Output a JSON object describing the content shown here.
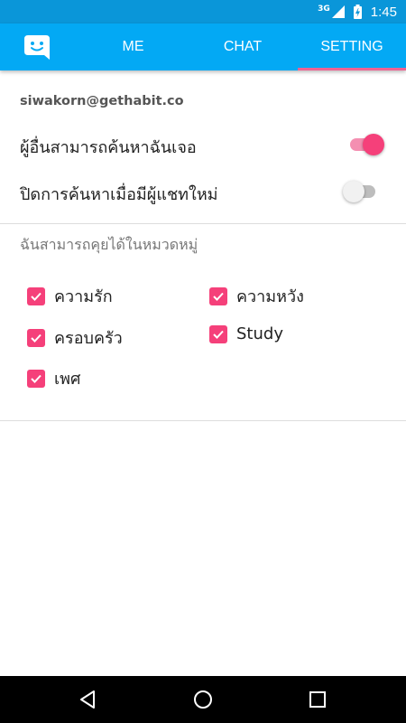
{
  "status_bar": {
    "network": "3G",
    "time": "1:45"
  },
  "app_bar": {
    "logo_icon": "smiley-chat-icon",
    "tabs": [
      {
        "label": "ME"
      },
      {
        "label": "CHAT"
      },
      {
        "label": "SETTING"
      }
    ],
    "active_tab": "SETTING"
  },
  "account": {
    "email": "siwakorn@gethabit.co"
  },
  "settings": [
    {
      "label": "ผู้อื่นสามารถค้นหาฉันเจอ",
      "enabled": true
    },
    {
      "label": "ปิดการค้นหาเมื่อมีผู้แชทใหม่",
      "enabled": false
    }
  ],
  "topics": {
    "title": "ฉันสามารถคุยได้ในหมวดหมู่",
    "items": [
      {
        "label": "ความรัก",
        "checked": true
      },
      {
        "label": "ความหวัง",
        "checked": true
      },
      {
        "label": "ครอบครัว",
        "checked": true
      },
      {
        "label": "Study",
        "checked": true
      },
      {
        "label": "เพศ",
        "checked": true
      }
    ]
  },
  "nav_bar": {
    "icons": [
      "back-icon",
      "home-icon",
      "recents-icon"
    ]
  },
  "colors": {
    "status_bar": "#0a96d9",
    "app_bar": "#03a9f4",
    "accent": "#f5407a"
  }
}
